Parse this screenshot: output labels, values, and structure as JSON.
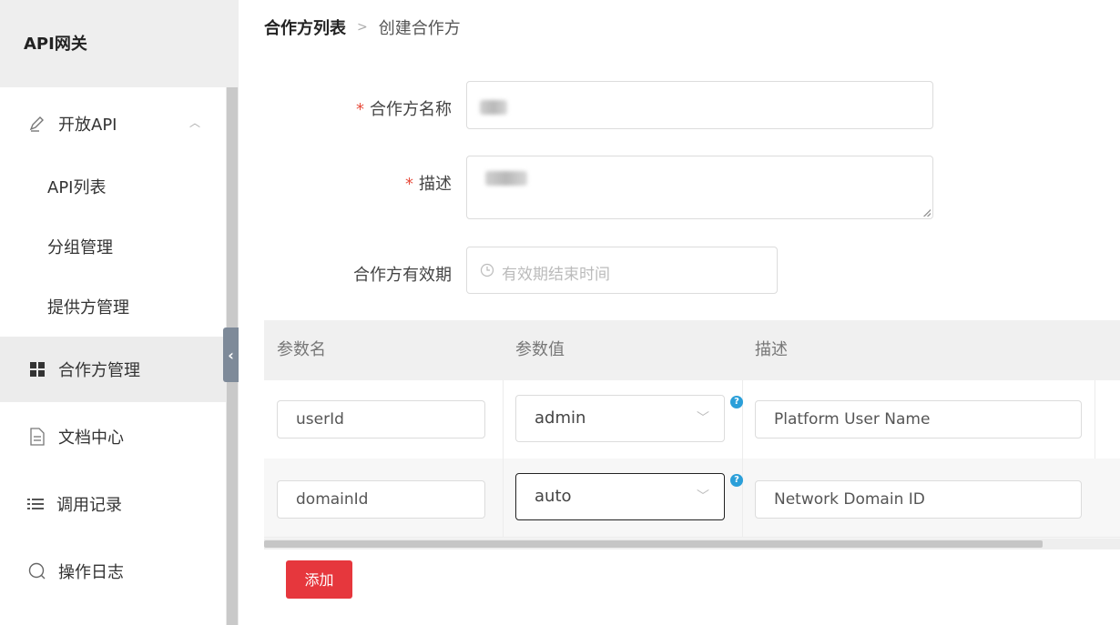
{
  "brand": {
    "title": "API网关"
  },
  "sidebar": {
    "open_api": {
      "label": "开放API"
    },
    "sub_items": [
      {
        "label": "API列表"
      },
      {
        "label": "分组管理"
      },
      {
        "label": "提供方管理"
      }
    ],
    "items": [
      {
        "label": "合作方管理",
        "icon": "grid-icon",
        "active": true
      },
      {
        "label": "文档中心",
        "icon": "document-icon"
      },
      {
        "label": "调用记录",
        "icon": "list-icon"
      },
      {
        "label": "操作日志",
        "icon": "search-icon"
      }
    ]
  },
  "breadcrumb": {
    "parent": "合作方列表",
    "separator": ">",
    "current": "创建合作方"
  },
  "form": {
    "name": {
      "label": "合作方名称"
    },
    "description": {
      "label": "描述"
    },
    "validity": {
      "label": "合作方有效期",
      "placeholder": "有效期结束时间"
    }
  },
  "table": {
    "headers": [
      "参数名",
      "参数值",
      "描述"
    ],
    "rows": [
      {
        "name": "userId",
        "value": "admin",
        "description": "Platform User Name"
      },
      {
        "name": "domainId",
        "value": "auto",
        "description": "Network Domain ID"
      }
    ]
  },
  "actions": {
    "add_label": "添加"
  },
  "colors": {
    "accent": "#e6373d",
    "help_icon": "#2b9fd9",
    "required": "#e74c3c"
  }
}
